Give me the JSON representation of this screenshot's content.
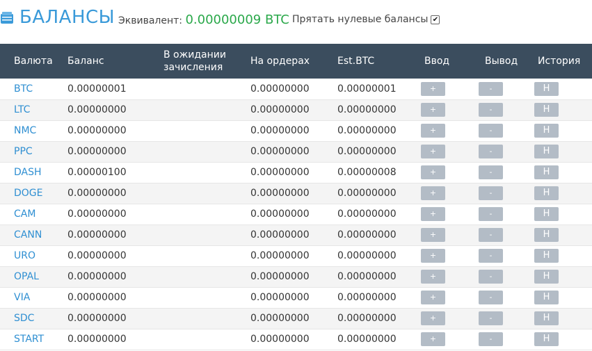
{
  "header": {
    "title": "БАЛАНСЫ",
    "equivalent_label": "Эквивалент:",
    "equivalent_value": "0.00000009 BTC",
    "hide_zero_label": "Прятать нулевые балансы",
    "hide_zero_checked": true
  },
  "table": {
    "columns": {
      "currency": "Валюта",
      "balance": "Баланс",
      "pending_line1": "В ожидании",
      "pending_line2": "зачисления",
      "on_orders": "На ордерах",
      "est_btc": "Est.BTC",
      "deposit": "Ввод",
      "withdraw": "Вывод",
      "history": "История"
    },
    "deposit_button": "+",
    "withdraw_button": "-",
    "history_button": "H",
    "rows": [
      {
        "currency": "BTC",
        "balance": "0.00000001",
        "pending": "",
        "orders": "0.00000000",
        "est": "0.00000001"
      },
      {
        "currency": "LTC",
        "balance": "0.00000000",
        "pending": "",
        "orders": "0.00000000",
        "est": "0.00000000"
      },
      {
        "currency": "NMC",
        "balance": "0.00000000",
        "pending": "",
        "orders": "0.00000000",
        "est": "0.00000000"
      },
      {
        "currency": "PPC",
        "balance": "0.00000000",
        "pending": "",
        "orders": "0.00000000",
        "est": "0.00000000"
      },
      {
        "currency": "DASH",
        "balance": "0.00000100",
        "pending": "",
        "orders": "0.00000000",
        "est": "0.00000008"
      },
      {
        "currency": "DOGE",
        "balance": "0.00000000",
        "pending": "",
        "orders": "0.00000000",
        "est": "0.00000000"
      },
      {
        "currency": "CAM",
        "balance": "0.00000000",
        "pending": "",
        "orders": "0.00000000",
        "est": "0.00000000"
      },
      {
        "currency": "CANN",
        "balance": "0.00000000",
        "pending": "",
        "orders": "0.00000000",
        "est": "0.00000000"
      },
      {
        "currency": "URO",
        "balance": "0.00000000",
        "pending": "",
        "orders": "0.00000000",
        "est": "0.00000000"
      },
      {
        "currency": "OPAL",
        "balance": "0.00000000",
        "pending": "",
        "orders": "0.00000000",
        "est": "0.00000000"
      },
      {
        "currency": "VIA",
        "balance": "0.00000000",
        "pending": "",
        "orders": "0.00000000",
        "est": "0.00000000"
      },
      {
        "currency": "SDC",
        "balance": "0.00000000",
        "pending": "",
        "orders": "0.00000000",
        "est": "0.00000000"
      },
      {
        "currency": "START",
        "balance": "0.00000000",
        "pending": "",
        "orders": "0.00000000",
        "est": "0.00000000"
      }
    ]
  },
  "colors": {
    "title": "#3a9ad9",
    "equivalent_value": "#2aa84a",
    "table_header": "#3b4d5e",
    "currency_link": "#2f8fd2",
    "button": "#b3bcc6"
  },
  "icons": {
    "title_icon": "wallet-icon",
    "checkbox": "checkbox"
  }
}
